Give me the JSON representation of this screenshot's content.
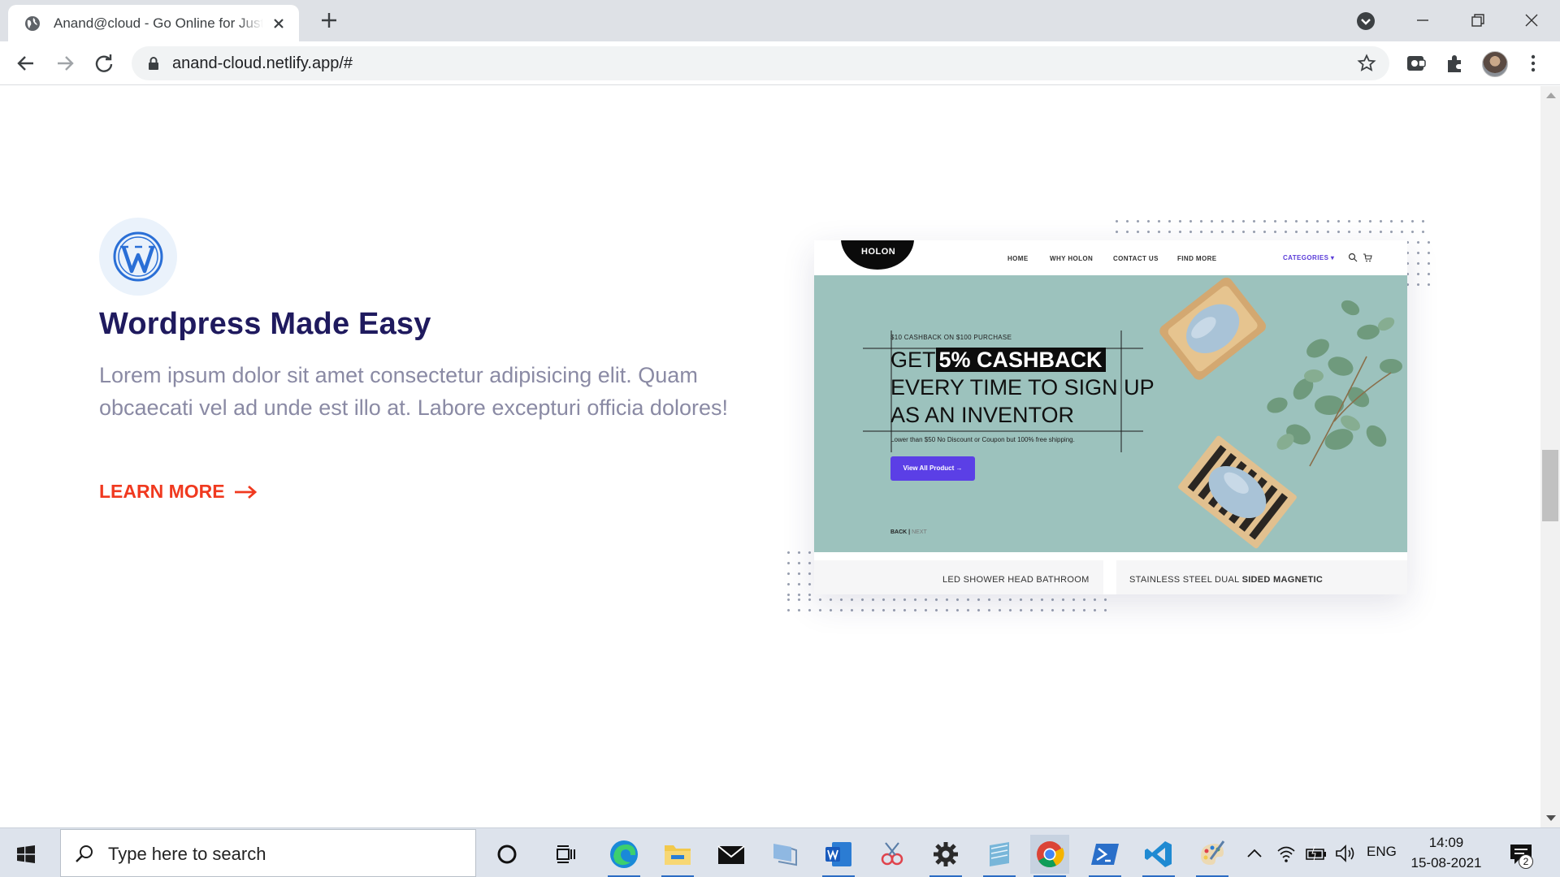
{
  "browser": {
    "tab_title": "Anand@cloud - Go Online for Just",
    "url": "anand-cloud.netlify.app/#"
  },
  "page": {
    "feature": {
      "title": "Wordpress Made Easy",
      "description": "Lorem ipsum dolor sit amet consectetur adipisicing elit. Quam obcaecati vel ad unde est illo at. Labore excepturi officia dolores!",
      "cta": "LEARN MORE",
      "accent_color": "#f0391f",
      "title_color": "#1f1a5e"
    },
    "mockup": {
      "logo": "HOLON",
      "nav": [
        "HOME",
        "WHY HOLON",
        "CONTACT US",
        "FIND MORE"
      ],
      "categories": "CATEGORIES ▾",
      "promo_small": "$10 CASHBACK ON $100 PURCHASE",
      "headline_prefix": "GET",
      "headline_highlight": "5% CASHBACK",
      "headline_line2": "EVERY TIME TO SIGN UP",
      "headline_line3": "AS AN INVENTOR",
      "subtext": "Lower than $50 No Discount or Coupon but 100% free shipping.",
      "button": "View All Product →",
      "back": "BACK",
      "next": "NEXT",
      "card1": "LED SHOWER HEAD BATHROOM",
      "card2_prefix": "STAINLESS STEEL DUAL",
      "card2_bold": "SIDED MAGNETIC"
    }
  },
  "taskbar": {
    "search_placeholder": "Type here to search",
    "language": "ENG",
    "time": "14:09",
    "date": "15-08-2021",
    "notification_count": "2"
  }
}
